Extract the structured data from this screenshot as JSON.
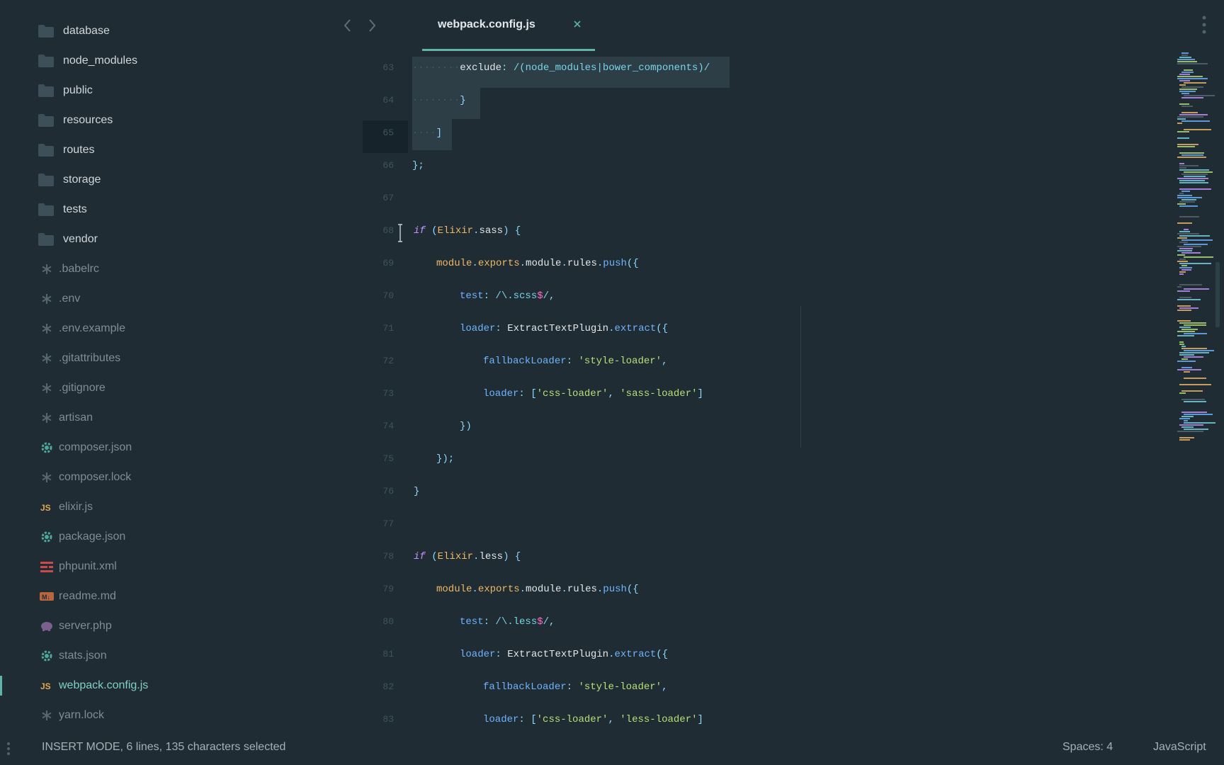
{
  "sidebar": {
    "items": [
      {
        "label": "database",
        "type": "folder",
        "icon": "folder-icon"
      },
      {
        "label": "node_modules",
        "type": "folder",
        "icon": "folder-icon"
      },
      {
        "label": "public",
        "type": "folder",
        "icon": "folder-icon"
      },
      {
        "label": "resources",
        "type": "folder",
        "icon": "folder-icon"
      },
      {
        "label": "routes",
        "type": "folder",
        "icon": "folder-icon"
      },
      {
        "label": "storage",
        "type": "folder",
        "icon": "folder-icon"
      },
      {
        "label": "tests",
        "type": "folder",
        "icon": "folder-icon"
      },
      {
        "label": "vendor",
        "type": "folder",
        "icon": "folder-icon"
      },
      {
        "label": ".babelrc",
        "type": "file",
        "icon": "asterisk-icon"
      },
      {
        "label": ".env",
        "type": "file",
        "icon": "asterisk-icon"
      },
      {
        "label": ".env.example",
        "type": "file",
        "icon": "asterisk-icon"
      },
      {
        "label": ".gitattributes",
        "type": "file",
        "icon": "asterisk-icon"
      },
      {
        "label": ".gitignore",
        "type": "file",
        "icon": "asterisk-icon"
      },
      {
        "label": "artisan",
        "type": "file",
        "icon": "asterisk-icon"
      },
      {
        "label": "composer.json",
        "type": "file",
        "icon": "gear-icon"
      },
      {
        "label": "composer.lock",
        "type": "file",
        "icon": "asterisk-icon"
      },
      {
        "label": "elixir.js",
        "type": "file",
        "icon": "js-icon"
      },
      {
        "label": "package.json",
        "type": "file",
        "icon": "gear-icon"
      },
      {
        "label": "phpunit.xml",
        "type": "file",
        "icon": "xml-icon"
      },
      {
        "label": "readme.md",
        "type": "file",
        "icon": "markdown-icon"
      },
      {
        "label": "server.php",
        "type": "file",
        "icon": "php-elephant-icon"
      },
      {
        "label": "stats.json",
        "type": "file",
        "icon": "gear-icon"
      },
      {
        "label": "webpack.config.js",
        "type": "file",
        "icon": "js-icon",
        "active": true
      },
      {
        "label": "yarn.lock",
        "type": "file",
        "icon": "asterisk-icon"
      }
    ]
  },
  "tab": {
    "title": "webpack.config.js",
    "close_icon": "close-icon"
  },
  "editor": {
    "line_numbers": [
      "63",
      "64",
      "65",
      "66",
      "67",
      "68",
      "69",
      "70",
      "71",
      "72",
      "73",
      "74",
      "75",
      "76",
      "77",
      "78",
      "79",
      "80",
      "81",
      "82",
      "83"
    ]
  },
  "status": {
    "message": "INSERT MODE, 6 lines, 135 characters selected",
    "spaces": "Spaces: 4",
    "language": "JavaScript"
  },
  "colors": {
    "background": "#1f2c33",
    "accent": "#5fb3a8",
    "keyword": "#c592ff",
    "string": "#b6e07a",
    "function": "#6fb4ff",
    "object": "#f0b866"
  }
}
